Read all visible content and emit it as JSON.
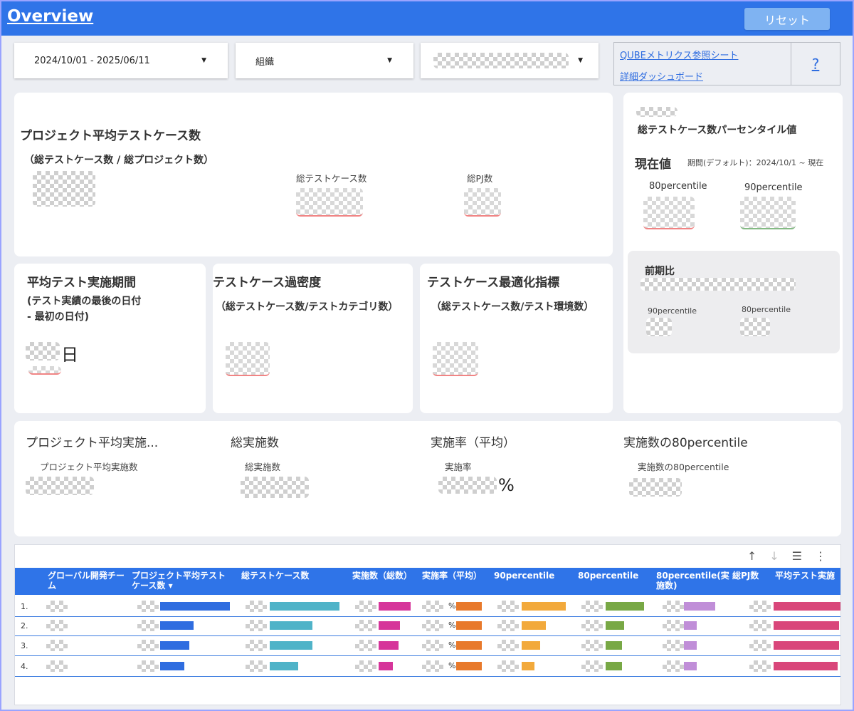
{
  "header": {
    "title": "Overview",
    "reset_label": "リセット"
  },
  "filters": {
    "date_range": "2024/10/01 - 2025/06/11",
    "org": "組織",
    "arrow": "▼"
  },
  "links": {
    "metrics_sheet": "QUBEメトリクス参照シート",
    "detail_dashboard": "詳細ダッシュボード",
    "help": "?"
  },
  "card_avg_test_cases": {
    "title": "プロジェクト平均テストケース数",
    "formula": "（総テストケース数 / 総プロジェクト数）",
    "total_cases_label": "総テストケース数",
    "total_pj_label": "総PJ数"
  },
  "card_percentile": {
    "title": "総テストケース数パーセンタイル値",
    "current_label": "現在値",
    "period_label": "期間(デフォルト)：2024/10/1 ~ 現在",
    "p80_label": "80percentile",
    "p90_label": "90percentile"
  },
  "card_previous": {
    "title": "前期比",
    "p90_label": "90percentile",
    "p80_label": "80percentile"
  },
  "card_avg_period": {
    "title": "平均テスト実施期間",
    "formula_line1": "(テスト実績の最後の日付",
    "formula_line2": "- 最初の日付)",
    "unit": "日"
  },
  "card_density": {
    "title": "テストケース過密度",
    "formula": "（総テストケース数/テストカテゴリ数）"
  },
  "card_optimization": {
    "title": "テストケース最適化指標",
    "formula": "（総テストケース数/テスト環境数）"
  },
  "execution": {
    "avg_title": "プロジェクト平均実施...",
    "avg_label": "プロジェクト平均実施数",
    "total_title": "総実施数",
    "total_label": "総実施数",
    "rate_title": "実施率（平均）",
    "rate_label": "実施率",
    "rate_unit": "%",
    "p80_title": "実施数の80percentile",
    "p80_label": "実施数の80percentile"
  },
  "table": {
    "tools": {
      "up": "↑",
      "down": "↓",
      "filter": "☰",
      "more": "⋮"
    },
    "columns": [
      "グローバル開発チーム",
      "プロジェクト平均テストケース数 ▾",
      "総テストケース数",
      "実施数（総数）",
      "実施率（平均）",
      "90percentile",
      "80percentile",
      "80percentile(実施数)",
      "総PJ数",
      "平均テスト実施"
    ],
    "rows": [
      {
        "num": "1.",
        "pct": "%"
      },
      {
        "num": "2.",
        "pct": "%"
      },
      {
        "num": "3.",
        "pct": "%"
      },
      {
        "num": "4.",
        "pct": "%"
      }
    ],
    "bar_colors": {
      "avg_cases": "#2f6de0",
      "total_cases": "#4fb3c8",
      "executions": "#d6359a",
      "rate": "#e8792b",
      "p90": "#f2a93b",
      "p80": "#78a845",
      "p80_exec": "#c08ed8",
      "avg_period": "#d9467a"
    }
  }
}
